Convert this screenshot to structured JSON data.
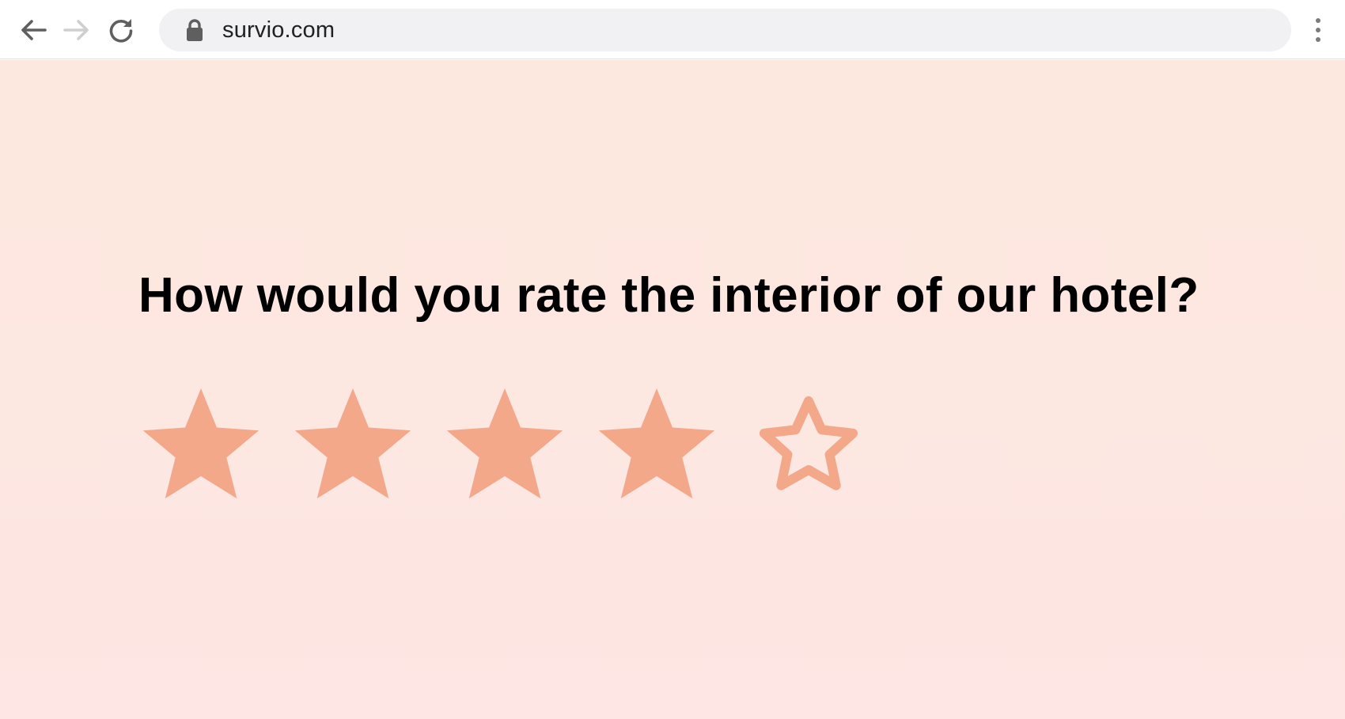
{
  "browser": {
    "url": "survio.com",
    "icons": {
      "back": "arrow-left-icon",
      "forward": "arrow-right-icon",
      "reload": "reload-icon",
      "lock": "lock-icon",
      "menu": "more-vertical-icon"
    }
  },
  "survey": {
    "question": "How would you rate the interior of our hotel?",
    "rating": {
      "value": 4,
      "max": 5
    },
    "colors": {
      "star": "#f2a889",
      "background": "#fde7e1"
    }
  }
}
